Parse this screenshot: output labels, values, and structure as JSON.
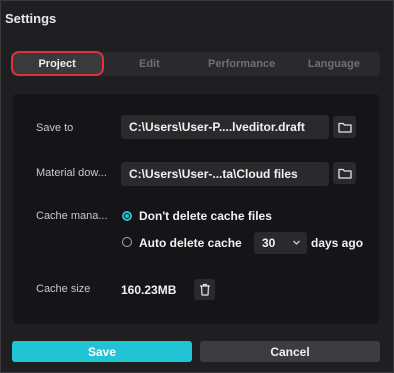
{
  "window": {
    "title": "Settings"
  },
  "tabs": [
    {
      "label": "Project",
      "active": true
    },
    {
      "label": "Edit",
      "active": false
    },
    {
      "label": "Performance",
      "active": false
    },
    {
      "label": "Language",
      "active": false
    }
  ],
  "settings": {
    "save_to": {
      "label": "Save to",
      "value": "C:\\Users\\User-P....lveditor.draft",
      "icon": "folder-icon"
    },
    "material_download": {
      "label": "Material dow...",
      "value": "C:\\Users\\User-...ta\\Cloud files",
      "icon": "folder-icon"
    },
    "cache_management": {
      "label": "Cache mana...",
      "option_keep": "Don't delete cache files",
      "option_auto": "Auto delete cache",
      "selected": "option_keep",
      "days_value": "30",
      "days_suffix": "days ago"
    },
    "cache_size": {
      "label": "Cache size",
      "value": "160.23MB",
      "icon": "trash-icon"
    }
  },
  "footer": {
    "save_label": "Save",
    "cancel_label": "Cancel"
  },
  "colors": {
    "accent": "#20c4d6",
    "highlight_border": "#e0313f"
  }
}
